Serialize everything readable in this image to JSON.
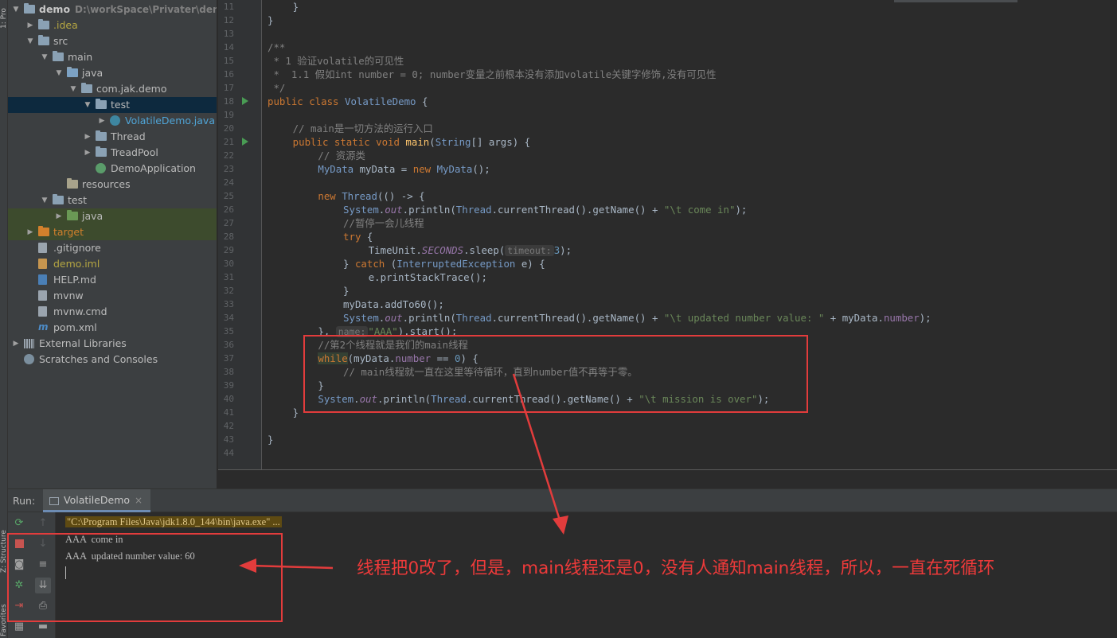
{
  "side_strip": {
    "top_label": "1: Pro",
    "structure_label": "Z: Structure",
    "favorites_label": "Favorites"
  },
  "project_tree": [
    {
      "label": "demo",
      "path": "D:\\workSpace\\Privater\\demo",
      "depth": 0,
      "arrow": "▼",
      "icon": "folder",
      "style": "bold"
    },
    {
      "label": ".idea",
      "depth": 1,
      "arrow": "▶",
      "icon": "folder",
      "style": "idea"
    },
    {
      "label": "src",
      "depth": 1,
      "arrow": "▼",
      "icon": "folder"
    },
    {
      "label": "main",
      "depth": 2,
      "arrow": "▼",
      "icon": "folder"
    },
    {
      "label": "java",
      "depth": 3,
      "arrow": "▼",
      "icon": "folder-src"
    },
    {
      "label": "com.jak.demo",
      "depth": 4,
      "arrow": "▼",
      "icon": "folder-pkg"
    },
    {
      "label": "test",
      "depth": 5,
      "arrow": "▼",
      "icon": "folder-pkg",
      "state": "selected"
    },
    {
      "label": "VolatileDemo.java",
      "depth": 6,
      "arrow": "▶",
      "icon": "class",
      "style": "java"
    },
    {
      "label": "Thread",
      "depth": 5,
      "arrow": "▶",
      "icon": "folder-pkg"
    },
    {
      "label": "TreadPool",
      "depth": 5,
      "arrow": "▶",
      "icon": "folder-pkg"
    },
    {
      "label": "DemoApplication",
      "depth": 5,
      "arrow": "",
      "icon": "spring-class"
    },
    {
      "label": "resources",
      "depth": 3,
      "arrow": "",
      "icon": "folder-res"
    },
    {
      "label": "test",
      "depth": 2,
      "arrow": "▼",
      "icon": "folder"
    },
    {
      "label": "java",
      "depth": 3,
      "arrow": "▶",
      "icon": "folder-test",
      "state": "highlight"
    },
    {
      "label": "target",
      "depth": 1,
      "arrow": "▶",
      "icon": "folder-excl",
      "style": "excl",
      "state": "highlight"
    },
    {
      "label": ".gitignore",
      "depth": 1,
      "arrow": "",
      "icon": "file"
    },
    {
      "label": "demo.iml",
      "depth": 1,
      "arrow": "",
      "icon": "file-iml",
      "style": "iml"
    },
    {
      "label": "HELP.md",
      "depth": 1,
      "arrow": "",
      "icon": "file-md"
    },
    {
      "label": "mvnw",
      "depth": 1,
      "arrow": "",
      "icon": "file"
    },
    {
      "label": "mvnw.cmd",
      "depth": 1,
      "arrow": "",
      "icon": "file"
    },
    {
      "label": "pom.xml",
      "depth": 1,
      "arrow": "",
      "icon": "file-xml"
    },
    {
      "label": "External Libraries",
      "depth": 0,
      "arrow": "▶",
      "icon": "libraries"
    },
    {
      "label": "Scratches and Consoles",
      "depth": 0,
      "arrow": "",
      "icon": "scratches"
    }
  ],
  "editor": {
    "lines": [
      {
        "n": "11",
        "indent": 4,
        "tokens": [
          [
            "",
            "}"
          ]
        ]
      },
      {
        "n": "12",
        "indent": 0,
        "tokens": [
          [
            "",
            "}"
          ]
        ]
      },
      {
        "n": "13",
        "indent": 0,
        "tokens": []
      },
      {
        "n": "14",
        "indent": 0,
        "tokens": [
          [
            "cm",
            "/**"
          ]
        ]
      },
      {
        "n": "15",
        "indent": 0,
        "tokens": [
          [
            "cm",
            " * 1 验证volatile的可见性"
          ]
        ]
      },
      {
        "n": "16",
        "indent": 0,
        "tokens": [
          [
            "cm",
            " *  1.1 假如int number = 0; number变量之前根本没有添加volatile关键字修饰,没有可见性"
          ]
        ]
      },
      {
        "n": "17",
        "indent": 0,
        "tokens": [
          [
            "cm",
            " */"
          ]
        ]
      },
      {
        "n": "18",
        "indent": 0,
        "run": true,
        "tokens": [
          [
            "kw",
            "public class "
          ],
          [
            "cls",
            "VolatileDemo"
          ],
          [
            "",
            " {"
          ]
        ]
      },
      {
        "n": "19",
        "indent": 0,
        "tokens": []
      },
      {
        "n": "20",
        "indent": 4,
        "tokens": [
          [
            "cm",
            "// main是一切方法的运行入口"
          ]
        ]
      },
      {
        "n": "21",
        "indent": 4,
        "run": true,
        "tokens": [
          [
            "kw",
            "public static void "
          ],
          [
            "mth",
            "main"
          ],
          [
            "",
            "("
          ],
          [
            "cls",
            "String"
          ],
          [
            "",
            "[] args) {"
          ]
        ]
      },
      {
        "n": "22",
        "indent": 8,
        "tokens": [
          [
            "cm",
            "// 资源类"
          ]
        ]
      },
      {
        "n": "23",
        "indent": 8,
        "tokens": [
          [
            "cls",
            "MyData"
          ],
          [
            "",
            " myData = "
          ],
          [
            "kw",
            "new "
          ],
          [
            "cls",
            "MyData"
          ],
          [
            "",
            "();"
          ]
        ]
      },
      {
        "n": "24",
        "indent": 0,
        "tokens": []
      },
      {
        "n": "25",
        "indent": 8,
        "tokens": [
          [
            "kw",
            "new "
          ],
          [
            "cls",
            "Thread"
          ],
          [
            "",
            "(() -> {"
          ]
        ]
      },
      {
        "n": "26",
        "indent": 12,
        "tokens": [
          [
            "cls",
            "System"
          ],
          [
            "",
            "."
          ],
          [
            "fld",
            "out"
          ],
          [
            "",
            ".println("
          ],
          [
            "cls",
            "Thread"
          ],
          [
            "",
            ".currentThread().getName() + "
          ],
          [
            "str",
            "\"\\t come in\""
          ],
          [
            "",
            ");"
          ]
        ]
      },
      {
        "n": "27",
        "indent": 12,
        "tokens": [
          [
            "cm",
            "//暂停一会儿线程"
          ]
        ]
      },
      {
        "n": "28",
        "indent": 12,
        "tokens": [
          [
            "kw",
            "try "
          ],
          [
            "",
            "{"
          ]
        ]
      },
      {
        "n": "29",
        "indent": 16,
        "tokens": [
          [
            "",
            "TimeUnit."
          ],
          [
            "fld",
            "SECONDS"
          ],
          [
            "",
            ".sleep("
          ],
          [
            "hint",
            "timeout:"
          ],
          [
            "num",
            "3"
          ],
          [
            "",
            ");"
          ]
        ]
      },
      {
        "n": "30",
        "indent": 12,
        "tokens": [
          [
            "",
            "} "
          ],
          [
            "kw",
            "catch "
          ],
          [
            "",
            "("
          ],
          [
            "cls",
            "InterruptedException"
          ],
          [
            "",
            " e) {"
          ]
        ]
      },
      {
        "n": "31",
        "indent": 16,
        "tokens": [
          [
            "",
            "e.printStackTrace();"
          ]
        ]
      },
      {
        "n": "32",
        "indent": 12,
        "tokens": [
          [
            "",
            "}"
          ]
        ]
      },
      {
        "n": "33",
        "indent": 12,
        "tokens": [
          [
            "",
            "myData.addTo60();"
          ]
        ]
      },
      {
        "n": "34",
        "indent": 12,
        "tokens": [
          [
            "cls",
            "System"
          ],
          [
            "",
            "."
          ],
          [
            "fld",
            "out"
          ],
          [
            "",
            ".println("
          ],
          [
            "cls",
            "Thread"
          ],
          [
            "",
            ".currentThread().getName() + "
          ],
          [
            "str",
            "\"\\t updated number value: \""
          ],
          [
            "",
            " + myData."
          ],
          [
            "ifld",
            "number"
          ],
          [
            "",
            ");"
          ]
        ]
      },
      {
        "n": "35",
        "indent": 8,
        "tokens": [
          [
            "",
            "}, "
          ],
          [
            "hint",
            "name:"
          ],
          [
            "str",
            "\"AAA\""
          ],
          [
            "",
            ").start();"
          ]
        ]
      },
      {
        "n": "36",
        "indent": 8,
        "tokens": [
          [
            "cm",
            "//第2个线程就是我们的main线程"
          ]
        ]
      },
      {
        "n": "37",
        "indent": 8,
        "tokens": [
          [
            "kw hlwhile",
            "while"
          ],
          [
            "",
            "(myData."
          ],
          [
            "ifld",
            "number"
          ],
          [
            "",
            " == "
          ],
          [
            "num",
            "0"
          ],
          [
            "",
            ") {"
          ]
        ]
      },
      {
        "n": "38",
        "indent": 12,
        "tokens": [
          [
            "cm",
            "// main线程就一直在这里等待循环，直到number值不再等于零。"
          ]
        ]
      },
      {
        "n": "39",
        "indent": 8,
        "tokens": [
          [
            "",
            "}"
          ]
        ]
      },
      {
        "n": "40",
        "indent": 8,
        "tokens": [
          [
            "cls",
            "System"
          ],
          [
            "",
            "."
          ],
          [
            "fld",
            "out"
          ],
          [
            "",
            ".println("
          ],
          [
            "cls",
            "Thread"
          ],
          [
            "",
            ".currentThread().getName() + "
          ],
          [
            "str",
            "\"\\t mission is over\""
          ],
          [
            "",
            ");"
          ]
        ]
      },
      {
        "n": "41",
        "indent": 4,
        "tokens": [
          [
            "",
            "}"
          ]
        ]
      },
      {
        "n": "42",
        "indent": 0,
        "tokens": []
      },
      {
        "n": "43",
        "indent": 0,
        "tokens": [
          [
            "",
            "}"
          ]
        ]
      },
      {
        "n": "44",
        "indent": 0,
        "tokens": []
      }
    ]
  },
  "run_panel": {
    "label": "Run:",
    "tab_label": "VolatileDemo",
    "tab_close": "×",
    "console_lines": [
      "\"C:\\Program Files\\Java\\jdk1.8.0_144\\bin\\java.exe\" ...",
      "AAA  come in",
      "AAA  updated number value: 60"
    ]
  },
  "annotation": {
    "text": "线程把0改了，但是，main线程还是0，没有人通知main线程，所以，一直在死循环",
    "color": "#ee3a3a"
  },
  "colors": {
    "keyword": "#cc7832",
    "comment": "#808080",
    "string": "#6a8759",
    "number": "#6897bb",
    "field": "#9876aa",
    "method": "#ffc66d",
    "class": "#769ac6",
    "annotation_red": "#e23c3c"
  }
}
